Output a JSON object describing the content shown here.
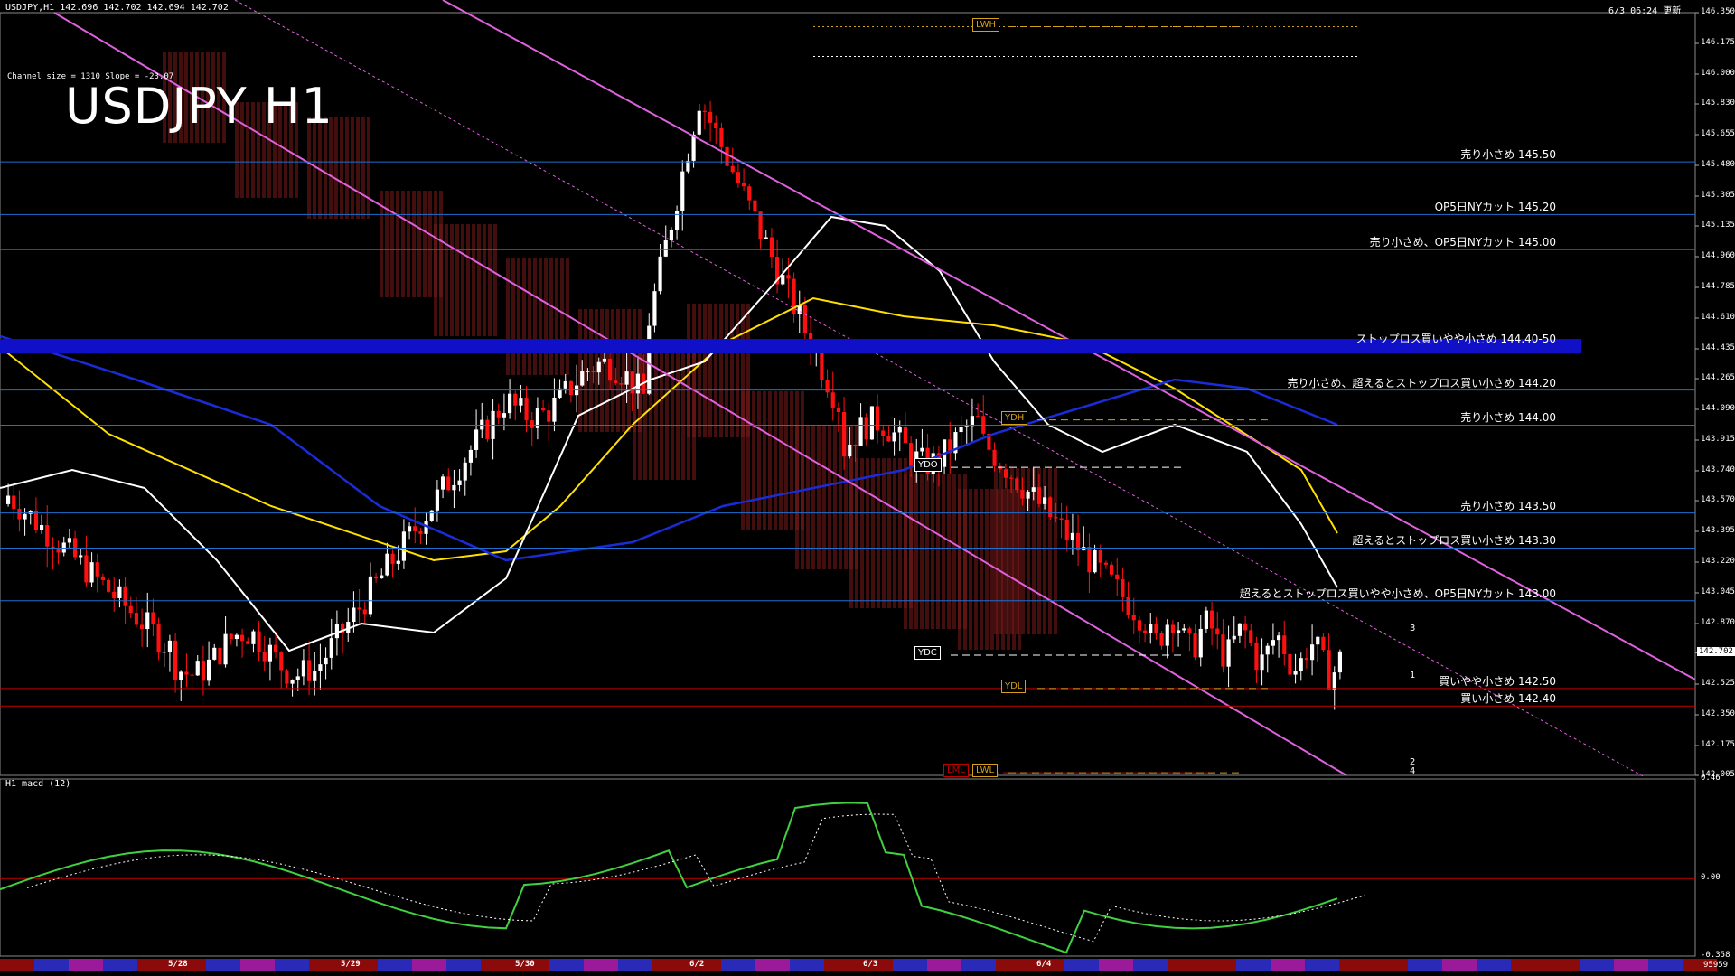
{
  "header": {
    "symbol_info": "USDJPY,H1  142.696 142.702 142.694 142.702",
    "updated": "6/3 06:24 更新",
    "channel_info": "Channel size = 1310 Slope = -23.07",
    "big_title": "USDJPY H1",
    "macd_title": "H1  macd (12)"
  },
  "chart_data": {
    "type": "candlestick",
    "title": "USDJPY H1",
    "price_axis": {
      "range": [
        142.005,
        146.35
      ],
      "ticks": [
        146.35,
        146.175,
        146.0,
        145.83,
        145.655,
        145.48,
        145.305,
        145.135,
        144.96,
        144.785,
        144.61,
        144.435,
        144.265,
        144.09,
        143.915,
        143.74,
        143.57,
        143.395,
        143.22,
        143.045,
        142.87,
        142.702,
        142.525,
        142.35,
        142.175,
        142.005
      ],
      "current_price": "142.702"
    },
    "date_labels": [
      "5/28",
      "5/29",
      "5/30",
      "6/2",
      "6/3",
      "6/4"
    ],
    "levels": [
      {
        "price": 145.5,
        "text": "売り小さめ 145.50",
        "color": "#1e6fd0"
      },
      {
        "price": 145.2,
        "text": "OP5日NYカット 145.20",
        "color": "#1e6fd0"
      },
      {
        "price": 145.0,
        "text": "売り小さめ、OP5日NYカット 145.00",
        "color": "#1e6fd0"
      },
      {
        "price": 144.45,
        "text": "ストップロス買いやや小さめ 144.40-50",
        "color": "#1010c8"
      },
      {
        "price": 144.2,
        "text": "売り小さめ、超えるとストップロス買い小さめ 144.20",
        "color": "#1e6fd0"
      },
      {
        "price": 144.0,
        "text": "売り小さめ 144.00",
        "color": "#1e6fd0"
      },
      {
        "price": 143.5,
        "text": "売り小さめ 143.50",
        "color": "#1e6fd0"
      },
      {
        "price": 143.3,
        "text": "超えるとストップロス買い小さめ 143.30",
        "color": "#1e6fd0"
      },
      {
        "price": 143.0,
        "text": "超えるとストップロス買いやや小さめ、OP5日NYカット 143.00",
        "color": "#1e6fd0"
      },
      {
        "price": 142.5,
        "text": "買いやや小さめ 142.50",
        "color": "#c00000"
      },
      {
        "price": 142.4,
        "text": "買い小さめ 142.40",
        "color": "#c00000"
      }
    ],
    "markers": [
      {
        "text": "LWH",
        "price": 146.27,
        "color": "#d4a017"
      },
      {
        "text": "YDH",
        "price": 144.03,
        "color": "#d4a017"
      },
      {
        "text": "YDO",
        "price": 143.76,
        "color": "#ffffff"
      },
      {
        "text": "YDC",
        "price": 142.69,
        "color": "#ffffff"
      },
      {
        "text": "YDL",
        "price": 142.5,
        "color": "#d4a017"
      },
      {
        "text": "LML",
        "price": 142.02,
        "color": "#c00000"
      },
      {
        "text": "LWL",
        "price": 142.02,
        "color": "#d4a017"
      }
    ],
    "projection_labels": [
      "3",
      "1",
      "2",
      "4"
    ],
    "macd": {
      "range": [
        -0.358,
        0.46
      ],
      "ticks": [
        "0.46",
        "0.00",
        "-0.358"
      ]
    },
    "footer_right": "95959"
  }
}
